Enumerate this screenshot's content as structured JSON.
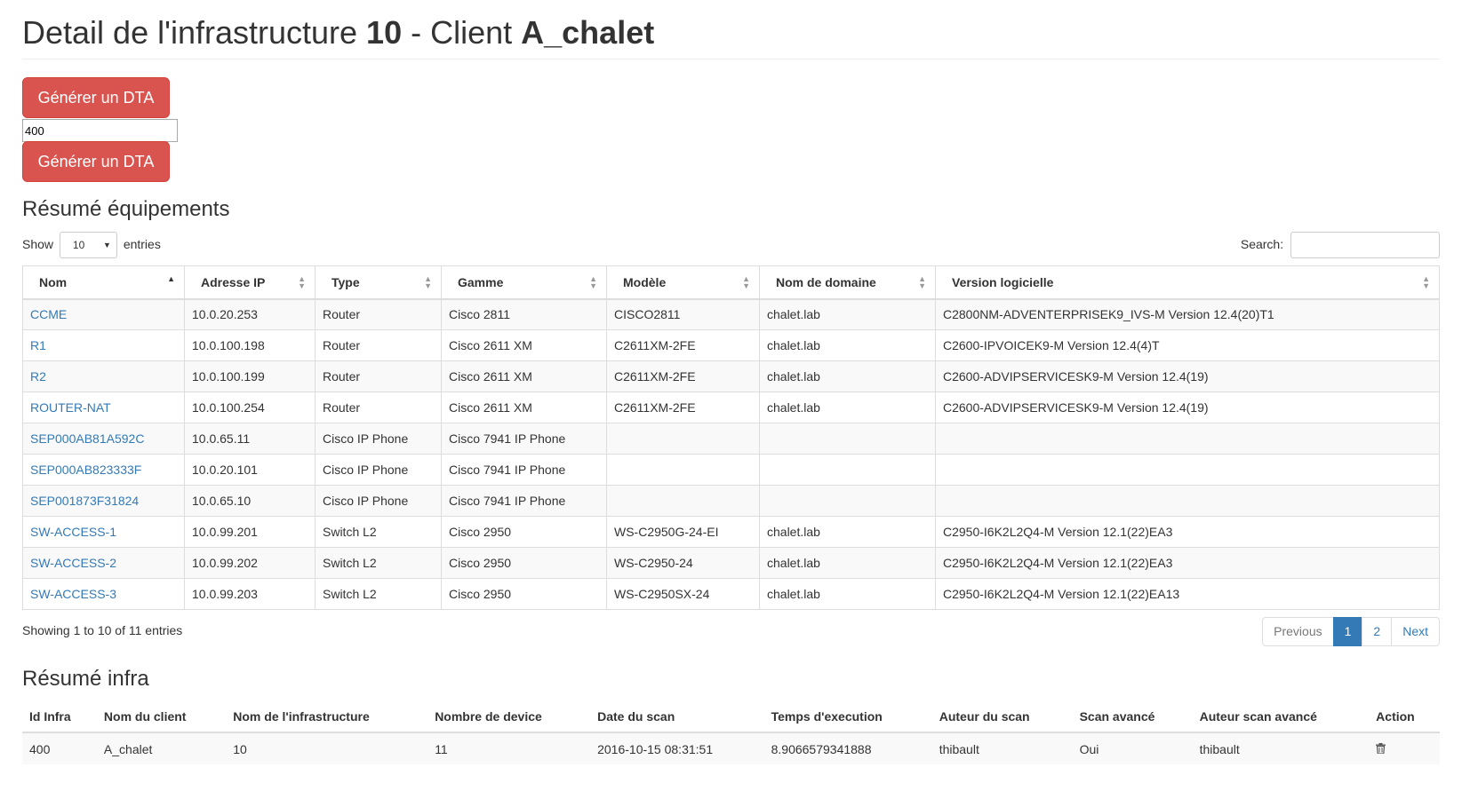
{
  "header": {
    "title_prefix": "Detail de l'infrastructure ",
    "infra_id": "10",
    "title_mid": " - Client ",
    "client": "A_chalet"
  },
  "actions": {
    "generate_label_1": "Générer un DTA",
    "input_value": "400",
    "generate_label_2": "Générer un DTA"
  },
  "equipment": {
    "title": "Résumé équipements",
    "show_label": "Show",
    "page_size": "10",
    "entries_label": "entries",
    "search_label": "Search:",
    "columns": [
      "Nom",
      "Adresse IP",
      "Type",
      "Gamme",
      "Modèle",
      "Nom de domaine",
      "Version logicielle"
    ],
    "rows": [
      [
        "CCME",
        "10.0.20.253",
        "Router",
        "Cisco 2811",
        "CISCO2811",
        "chalet.lab",
        "C2800NM-ADVENTERPRISEK9_IVS-M Version 12.4(20)T1"
      ],
      [
        "R1",
        "10.0.100.198",
        "Router",
        "Cisco 2611 XM",
        "C2611XM-2FE",
        "chalet.lab",
        "C2600-IPVOICEK9-M Version 12.4(4)T"
      ],
      [
        "R2",
        "10.0.100.199",
        "Router",
        "Cisco 2611 XM",
        "C2611XM-2FE",
        "chalet.lab",
        "C2600-ADVIPSERVICESK9-M Version 12.4(19)"
      ],
      [
        "ROUTER-NAT",
        "10.0.100.254",
        "Router",
        "Cisco 2611 XM",
        "C2611XM-2FE",
        "chalet.lab",
        "C2600-ADVIPSERVICESK9-M Version 12.4(19)"
      ],
      [
        "SEP000AB81A592C",
        "10.0.65.11",
        "Cisco IP Phone",
        "Cisco 7941 IP Phone",
        "",
        "",
        ""
      ],
      [
        "SEP000AB823333F",
        "10.0.20.101",
        "Cisco IP Phone",
        "Cisco 7941 IP Phone",
        "",
        "",
        ""
      ],
      [
        "SEP001873F31824",
        "10.0.65.10",
        "Cisco IP Phone",
        "Cisco 7941 IP Phone",
        "",
        "",
        ""
      ],
      [
        "SW-ACCESS-1",
        "10.0.99.201",
        "Switch L2",
        "Cisco 2950",
        "WS-C2950G-24-EI",
        "chalet.lab",
        "C2950-I6K2L2Q4-M Version 12.1(22)EA3"
      ],
      [
        "SW-ACCESS-2",
        "10.0.99.202",
        "Switch L2",
        "Cisco 2950",
        "WS-C2950-24",
        "chalet.lab",
        "C2950-I6K2L2Q4-M Version 12.1(22)EA3"
      ],
      [
        "SW-ACCESS-3",
        "10.0.99.203",
        "Switch L2",
        "Cisco 2950",
        "WS-C2950SX-24",
        "chalet.lab",
        "C2950-I6K2L2Q4-M Version 12.1(22)EA13"
      ]
    ],
    "info": "Showing 1 to 10 of 11 entries",
    "pagination": {
      "previous": "Previous",
      "pages": [
        "1",
        "2"
      ],
      "current": "1",
      "next": "Next"
    }
  },
  "infra": {
    "title": "Résumé infra",
    "columns": [
      "Id Infra",
      "Nom du client",
      "Nom de l'infrastructure",
      "Nombre de device",
      "Date du scan",
      "Temps d'execution",
      "Auteur du scan",
      "Scan avancé",
      "Auteur scan avancé",
      "Action"
    ],
    "row": [
      "400",
      "A_chalet",
      "10",
      "11",
      "2016-10-15 08:31:51",
      "8.9066579341888",
      "thibault",
      "Oui",
      "thibault"
    ],
    "action_icon": "trash-icon"
  },
  "colors": {
    "danger": "#d9534f",
    "link": "#337ab7",
    "active_page": "#337ab7"
  }
}
